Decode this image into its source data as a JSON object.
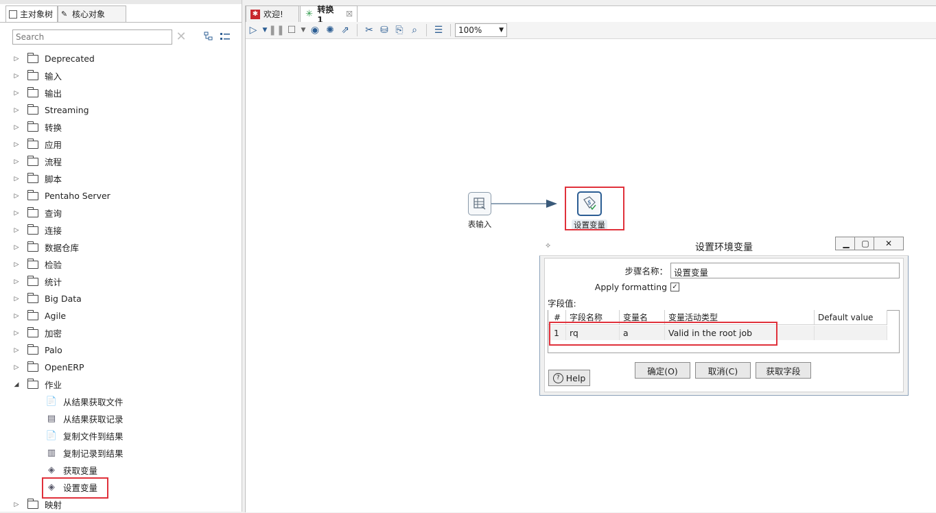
{
  "left_tabs": [
    {
      "label": "主对象树",
      "icon": "object-tree-icon"
    },
    {
      "label": "核心对象",
      "icon": "core-objects-icon"
    }
  ],
  "search": {
    "placeholder": "Search"
  },
  "tree": {
    "folders": [
      "Deprecated",
      "输入",
      "输出",
      "Streaming",
      "转换",
      "应用",
      "流程",
      "脚本",
      "Pentaho Server",
      "查询",
      "连接",
      "数据仓库",
      "检验",
      "统计",
      "Big Data",
      "Agile",
      "加密",
      "Palo",
      "OpenERP",
      "作业"
    ],
    "job_children": [
      "从结果获取文件",
      "从结果获取记录",
      "复制文件到结果",
      "复制记录到结果",
      "获取变量",
      "设置变量"
    ],
    "last_folder": "映射"
  },
  "editor_tabs": [
    {
      "label": "欢迎!",
      "icon": "welcome-icon"
    },
    {
      "label": "转换 1",
      "icon": "transformation-icon",
      "close": "☒"
    }
  ],
  "toolbar": {
    "zoom": "100%"
  },
  "canvas": {
    "step1_label": "表输入",
    "step2_label": "设置变量"
  },
  "dialog": {
    "title": "设置环境变量",
    "step_name_label": "步骤名称：",
    "step_name_value": "设置变量",
    "apply_formatting_label": "Apply formatting",
    "apply_formatting_checked": "✓",
    "fields_label": "字段值:",
    "columns": [
      "#",
      "字段名称",
      "变量名",
      "变量活动类型",
      "Default value"
    ],
    "rows": [
      {
        "num": "1",
        "field": "rq",
        "var": "a",
        "type": "Valid in the root job",
        "default": ""
      }
    ],
    "buttons": {
      "help": "Help",
      "ok": "确定(O)",
      "cancel": "取消(C)",
      "get_fields": "获取字段"
    }
  },
  "colors": {
    "highlight": "#e0303a",
    "accent": "#2b5d93"
  }
}
